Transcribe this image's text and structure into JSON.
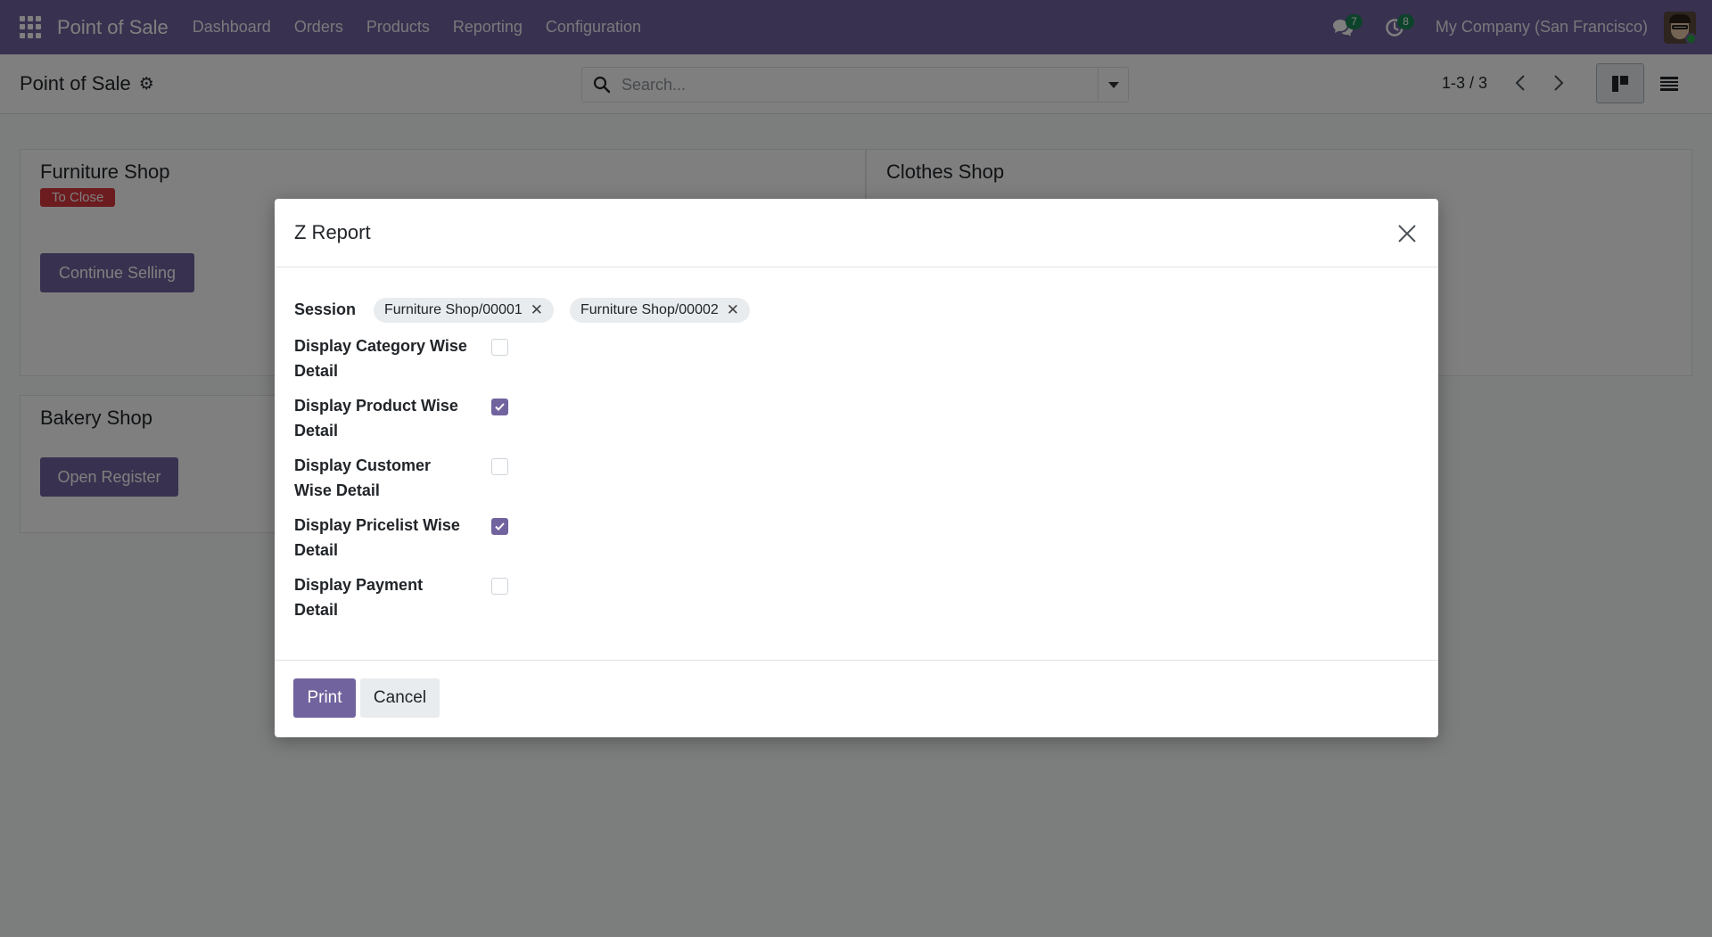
{
  "navbar": {
    "brand": "Point of Sale",
    "menu": [
      "Dashboard",
      "Orders",
      "Products",
      "Reporting",
      "Configuration"
    ],
    "messages_count": "7",
    "activities_count": "8",
    "company": "My Company (San Francisco)"
  },
  "control_panel": {
    "title": "Point of Sale",
    "search_placeholder": "Search...",
    "pager": "1-3 / 3"
  },
  "shops": [
    {
      "name": "Furniture Shop",
      "status": "To Close",
      "button": "Continue Selling"
    },
    {
      "name": "Clothes Shop"
    },
    {
      "name": "Bakery Shop",
      "button": "Open Register"
    }
  ],
  "dialog": {
    "title": "Z Report",
    "session_label": "Session",
    "sessions": [
      "Furniture Shop/00001",
      "Furniture Shop/00002"
    ],
    "options": [
      {
        "label_line1": "Display Category Wise",
        "label_line2": "Detail",
        "checked": false
      },
      {
        "label_line1": "Display Product Wise",
        "label_line2": "Detail",
        "checked": true
      },
      {
        "label_line1": "Display Customer",
        "label_line2": "Wise Detail",
        "checked": false
      },
      {
        "label_line1": "Display Pricelist Wise",
        "label_line2": "Detail",
        "checked": true
      },
      {
        "label_line1": "Display Payment",
        "label_line2": "Detail",
        "checked": false
      }
    ],
    "print_label": "Print",
    "cancel_label": "Cancel"
  },
  "colors": {
    "brand": "#71639e",
    "status_to_close": "#d9363e",
    "badge": "#198754"
  }
}
